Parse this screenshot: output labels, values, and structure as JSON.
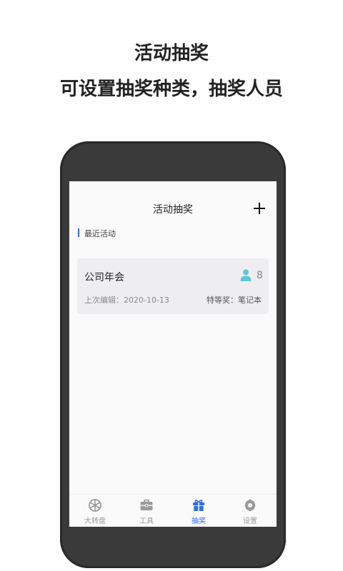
{
  "promo": {
    "line1": "活动抽奖",
    "line2": "可设置抽奖种类，抽奖人员"
  },
  "header": {
    "title": "活动抽奖",
    "add_icon": "plus-icon"
  },
  "section": {
    "title": "最近活动"
  },
  "activities": [
    {
      "name": "公司年会",
      "participant_icon": "person-icon",
      "participant_count": "8",
      "last_edited": "上次编辑：2020-10-13",
      "top_prize": "特等奖：笔记本"
    }
  ],
  "tabs": [
    {
      "label": "大转盘",
      "icon": "wheel-icon",
      "active": false
    },
    {
      "label": "工具",
      "icon": "toolbox-icon",
      "active": false
    },
    {
      "label": "抽奖",
      "icon": "gift-icon",
      "active": true
    },
    {
      "label": "设置",
      "icon": "gear-icon",
      "active": false
    }
  ],
  "colors": {
    "accent": "#2f6fe0",
    "person_icon": "#5cc8d6",
    "inactive_tab": "#9a9a9a",
    "card_bg": "#eeeef0",
    "phone_frame": "#3a3a3a"
  }
}
